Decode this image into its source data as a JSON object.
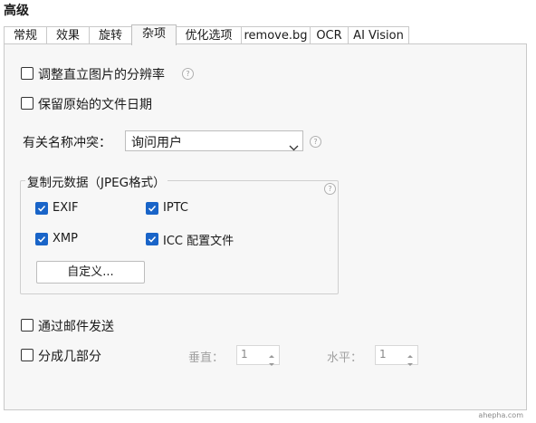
{
  "header": {
    "title": "高级"
  },
  "tabs": [
    {
      "label": "常规",
      "active": false
    },
    {
      "label": "效果",
      "active": false
    },
    {
      "label": "旋转",
      "active": false
    },
    {
      "label": "杂项",
      "active": true
    },
    {
      "label": "优化选项",
      "active": false
    },
    {
      "label": "remove.bg",
      "active": false
    },
    {
      "label": "OCR",
      "active": false
    },
    {
      "label": "AI Vision",
      "active": false
    }
  ],
  "options": {
    "adjust_dpi": {
      "label": "调整直立图片的分辨率",
      "checked": false
    },
    "keep_date": {
      "label": "保留原始的文件日期",
      "checked": false
    }
  },
  "conflict": {
    "label": "有关名称冲突：",
    "value": "询问用户"
  },
  "metadata": {
    "title": "复制元数据（JPEG格式）",
    "exif": {
      "label": "EXIF",
      "checked": true
    },
    "iptc": {
      "label": "IPTC",
      "checked": true
    },
    "xmp": {
      "label": "XMP",
      "checked": true
    },
    "icc": {
      "label": "ICC 配置文件",
      "checked": true
    },
    "custom_button": "自定义..."
  },
  "email": {
    "label": "通过邮件发送",
    "checked": false
  },
  "split": {
    "label": "分成几部分",
    "checked": false,
    "vertical_label": "垂直：",
    "vertical_value": "1",
    "horizontal_label": "水平：",
    "horizontal_value": "1"
  },
  "help_glyph": "?",
  "watermark": "ahepha.com",
  "colors": {
    "accent": "#1964c8",
    "panel": "#f7f7f7",
    "border": "#c9c9c9"
  },
  "icons": [
    "help-icon",
    "chevron-down-icon",
    "checkmark-icon",
    "spin-up-icon",
    "spin-down-icon"
  ]
}
